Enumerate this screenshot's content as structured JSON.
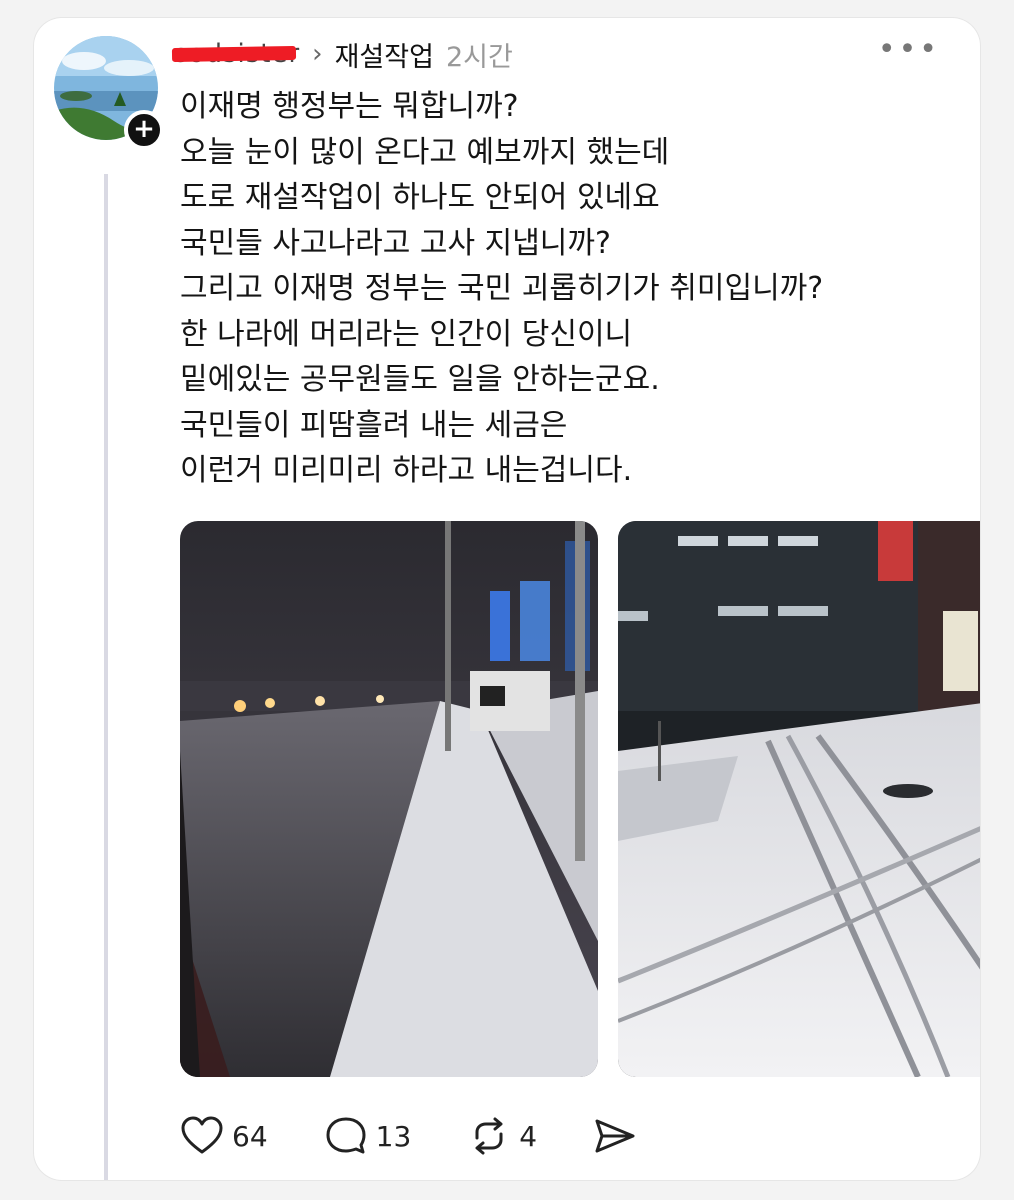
{
  "post": {
    "username": "sodsister",
    "topic": "재설작업",
    "time": "2시간",
    "more_icon": "more-horizontal-icon",
    "follow_icon": "plus-icon",
    "lines": [
      "이재명 행정부는 뭐합니까?",
      "오늘 눈이 많이 온다고 예보까지 했는데",
      "도로 재설작업이 하나도 안되어 있네요",
      "국민들 사고나라고 고사 지냅니까?",
      "그리고 이재명 정부는 국민 괴롭히기가 취미입니까?",
      "한 나라에 머리라는 인간이 당신이니",
      "밑에있는 공무원들도 일을 안하는군요.",
      "국민들이 피땀흘려 내는 세금은",
      "이런거 미리미리 하라고 내는겁니다."
    ],
    "images": [
      {
        "desc_icon": "snowy-street-night-photo"
      },
      {
        "desc_icon": "snowy-sidewalk-tire-tracks-photo"
      }
    ]
  },
  "actions": {
    "likes": "64",
    "comments": "13",
    "reposts": "4",
    "icons": [
      "heart-icon",
      "comment-icon",
      "repost-icon",
      "share-icon"
    ]
  }
}
